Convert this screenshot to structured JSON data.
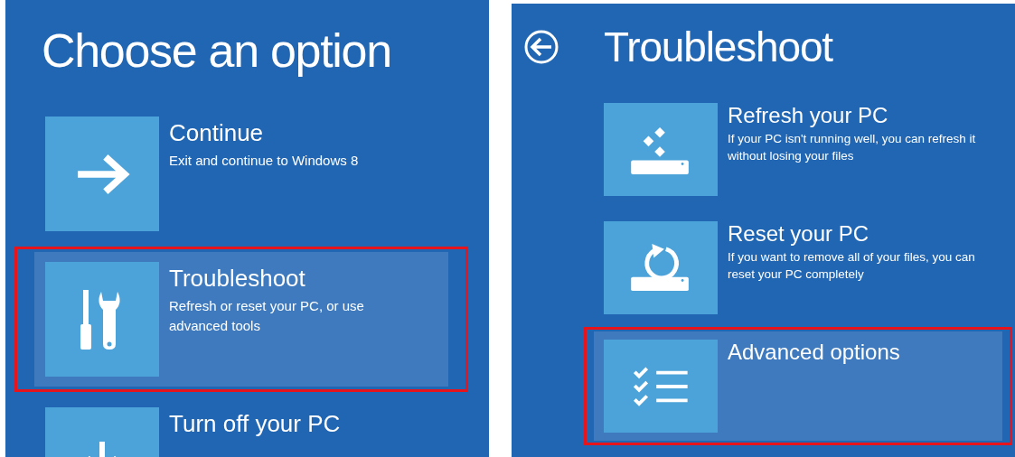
{
  "choose_panel": {
    "title": "Choose an option",
    "options": [
      {
        "title": "Continue",
        "description": "Exit and continue to Windows 8",
        "kind": "arrow",
        "selected": false
      },
      {
        "title": "Troubleshoot",
        "description": "Refresh or reset your PC, or use advanced tools",
        "kind": "tools",
        "selected": true
      },
      {
        "title": "Turn off your PC",
        "kind": "power",
        "selected": false
      }
    ]
  },
  "troubleshoot_panel": {
    "title": "Troubleshoot",
    "options": [
      {
        "title": "Refresh your PC",
        "description": "If your PC isn't running well, you can refresh it without losing your files",
        "kind": "refresh",
        "selected": false
      },
      {
        "title": "Reset your PC",
        "description": "If you want to remove all of your files, you can reset your PC completely",
        "kind": "reset",
        "selected": false
      },
      {
        "title": "Advanced options",
        "kind": "checklist",
        "selected": true
      }
    ]
  }
}
